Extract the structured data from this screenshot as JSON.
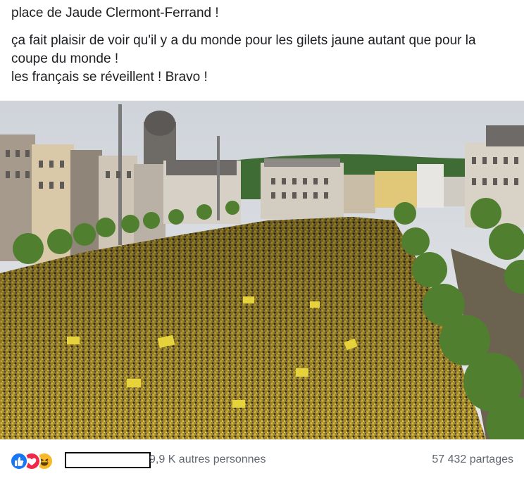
{
  "post": {
    "text_line1": "place de Jaude Clermont-Ferrand !",
    "text_line2": "ça fait plaisir de voir qu'il y a du monde pour les gilets jaune autant que pour la coupe du monde !",
    "text_line3": "les français se réveillent ! Bravo !"
  },
  "photo": {
    "sky_color": "#d8dde2",
    "crowd_color": "#b69a2e",
    "tree_color": "#4f7f2f"
  },
  "reactions": {
    "icons": [
      "like-icon",
      "love-icon",
      "haha-icon"
    ],
    "others_text": "9,9 K autres personnes",
    "shares_text": "57 432 partages"
  }
}
